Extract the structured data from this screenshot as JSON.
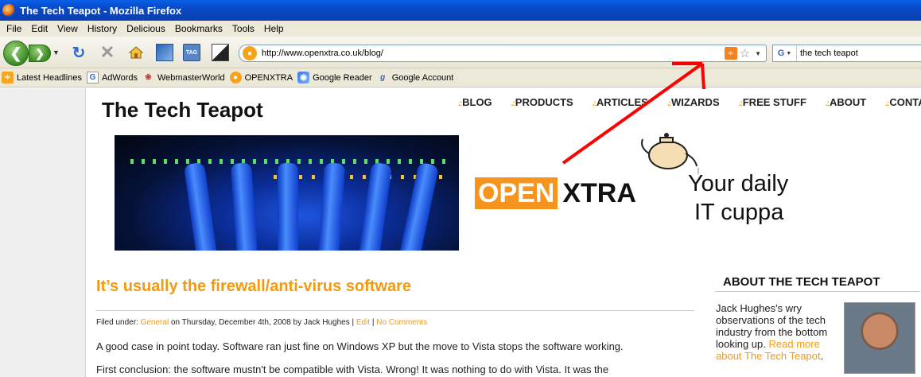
{
  "window": {
    "title": "The Tech Teapot - Mozilla Firefox"
  },
  "menu": [
    "File",
    "Edit",
    "View",
    "History",
    "Delicious",
    "Bookmarks",
    "Tools",
    "Help"
  ],
  "toolbar": {
    "url": "http://www.openxtra.co.uk/blog/",
    "search_value": "the tech teapot",
    "search_engine": "G",
    "tag_label": "TAG"
  },
  "bookmarks": [
    {
      "label": "Latest Headlines",
      "icon": "rss-icon"
    },
    {
      "label": "AdWords",
      "icon": "google-icon"
    },
    {
      "label": "WebmasterWorld",
      "icon": "webmasterworld-icon"
    },
    {
      "label": "OPENXTRA",
      "icon": "openxtra-icon"
    },
    {
      "label": "Google Reader",
      "icon": "google-reader-icon"
    },
    {
      "label": "Google Account",
      "icon": "google-account-icon"
    }
  ],
  "site": {
    "title": "The Tech Teapot",
    "nav": [
      "BLOG",
      "PRODUCTS",
      "ARTICLES",
      "WIZARDS",
      "FREE STUFF",
      "ABOUT",
      "CONTACT"
    ],
    "logo_open": "OPEN",
    "logo_xtra": "XTRA",
    "tagline_1": "Your daily",
    "tagline_2": "IT cuppa"
  },
  "post": {
    "title": "It’s usually the firewall/anti-virus software",
    "meta_prefix": "Filed under:",
    "category": "General",
    "meta_mid": "on Thursday, December 4th, 2008 by Jack Hughes |",
    "edit": "Edit",
    "sep": "|",
    "comments": "No Comments",
    "p1": "A good case in point today. Software ran just fine on Windows XP but the move to Vista stops the software working.",
    "p2": "First conclusion: the software mustn't be compatible with Vista. Wrong! It was nothing to do with Vista. It was the"
  },
  "sidebar": {
    "heading": "ABOUT THE TECH TEAPOT",
    "text": "Jack Hughes's wry observations of the tech industry from the bottom looking up.",
    "link": "Read more about The Tech Teapot",
    "suffix": "."
  },
  "colors": {
    "accent": "#f39a10",
    "annotation_arrow": "#ff0000",
    "titlebar": "#0a4fd6"
  }
}
